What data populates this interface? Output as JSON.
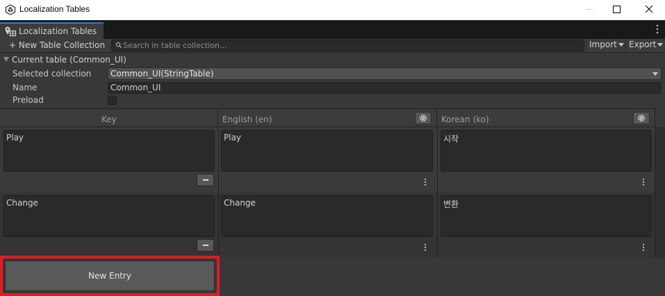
{
  "window": {
    "title": "Localization Tables",
    "controls": [
      "minimize",
      "maximize",
      "close"
    ]
  },
  "tab": {
    "label": "Localization Tables"
  },
  "toolbar": {
    "new_collection": "+ New Table Collection",
    "search_placeholder": "Search in table collection...",
    "import_label": "Import",
    "export_label": "Export"
  },
  "current_table": {
    "foldout_label": "Current table (Common_UI)",
    "selected_collection_label": "Selected collection",
    "selected_collection_value": "Common_UI(StringTable)",
    "name_label": "Name",
    "name_value": "Common_UI",
    "preload_label": "Preload",
    "preload_checked": false
  },
  "table": {
    "columns": [
      {
        "label": "Key"
      },
      {
        "label": "English (en)",
        "icon": "gear-icon"
      },
      {
        "label": "Korean (ko)",
        "icon": "gear-icon"
      }
    ],
    "rows": [
      {
        "key": "Play",
        "en": "Play",
        "ko": "시작"
      },
      {
        "key": "Change",
        "en": "Change",
        "ko": "변환"
      }
    ],
    "new_entry_label": "New Entry"
  },
  "colors": {
    "background": "#383838",
    "field": "#2a2a2a",
    "highlight_border": "#e01b24",
    "tab_accent": "#3a79bb"
  }
}
